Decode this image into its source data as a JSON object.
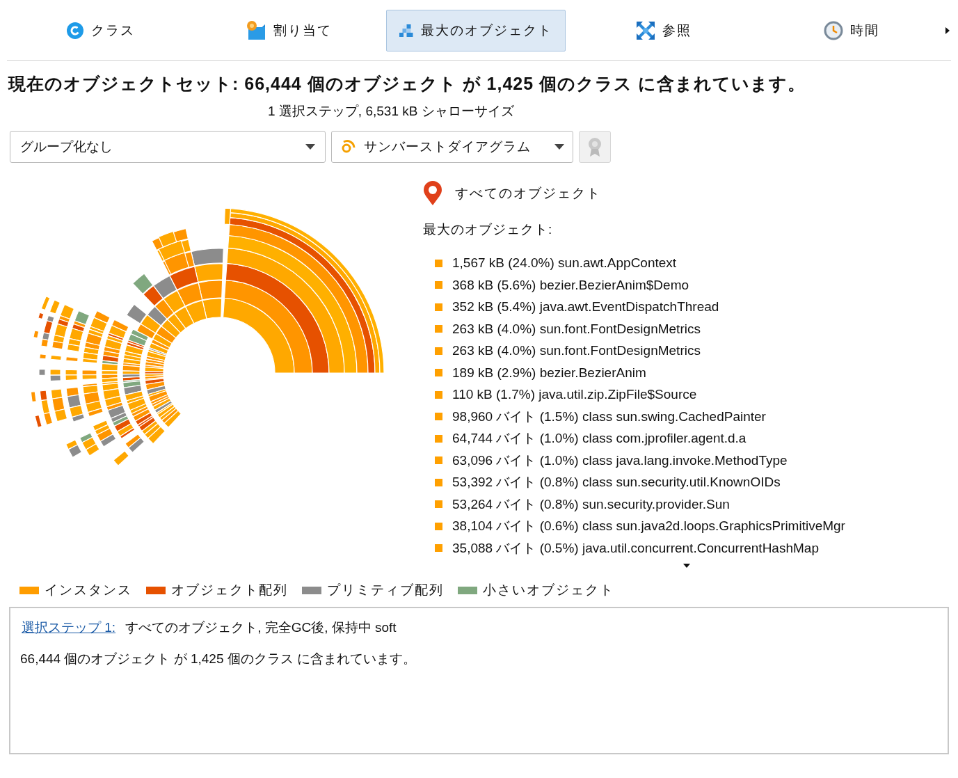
{
  "tabs": [
    {
      "label": "クラス",
      "selected": false
    },
    {
      "label": "割り当て",
      "selected": false
    },
    {
      "label": "最大のオブジェクト",
      "selected": true
    },
    {
      "label": "参照",
      "selected": false
    },
    {
      "label": "時間",
      "selected": false
    }
  ],
  "heading": "現在のオブジェクトセット:  66,444 個のオブジェクト が 1,425 個のクラス に含まれています。",
  "subheading": "1 選択ステップ, 6,531 kB シャローサイズ",
  "grouping_dropdown": {
    "value": "グループ化なし"
  },
  "view_dropdown": {
    "value": "サンバーストダイアグラム"
  },
  "settings_button": {
    "disabled": true
  },
  "breadcrumb": "すべてのオブジェクト",
  "list_title": "最大のオブジェクト:",
  "objects": [
    "1,567 kB (24.0%) sun.awt.AppContext",
    "368 kB (5.6%) bezier.BezierAnim$Demo",
    "352 kB (5.4%) java.awt.EventDispatchThread",
    "263 kB (4.0%) sun.font.FontDesignMetrics",
    "263 kB (4.0%) sun.font.FontDesignMetrics",
    "189 kB (2.9%) bezier.BezierAnim",
    "110 kB (1.7%) java.util.zip.ZipFile$Source",
    "98,960 バイト (1.5%) class sun.swing.CachedPainter",
    "64,744 バイト (1.0%) class com.jprofiler.agent.d.a",
    "63,096 バイト (1.0%) class java.lang.invoke.MethodType",
    "53,392 バイト (0.8%) class sun.security.util.KnownOIDs",
    "53,264 バイト (0.8%) sun.security.provider.Sun",
    "38,104 バイト (0.6%) class sun.java2d.loops.GraphicsPrimitiveMgr",
    "35,088 バイト (0.5%) java.util.concurrent.ConcurrentHashMap"
  ],
  "legend": [
    {
      "label": "インスタンス",
      "color": "#ff9d00"
    },
    {
      "label": "オブジェクト配列",
      "color": "#e65100"
    },
    {
      "label": "プリミティブ配列",
      "color": "#8c8c8c"
    },
    {
      "label": "小さいオブジェクト",
      "color": "#80a87f"
    }
  ],
  "details": {
    "link": "選択ステップ 1:",
    "description": "すべてのオブジェクト, 完全GC後, 保持中 soft",
    "summary": "66,444 個のオブジェクト が 1,425 個のクラス に含まれています。"
  }
}
